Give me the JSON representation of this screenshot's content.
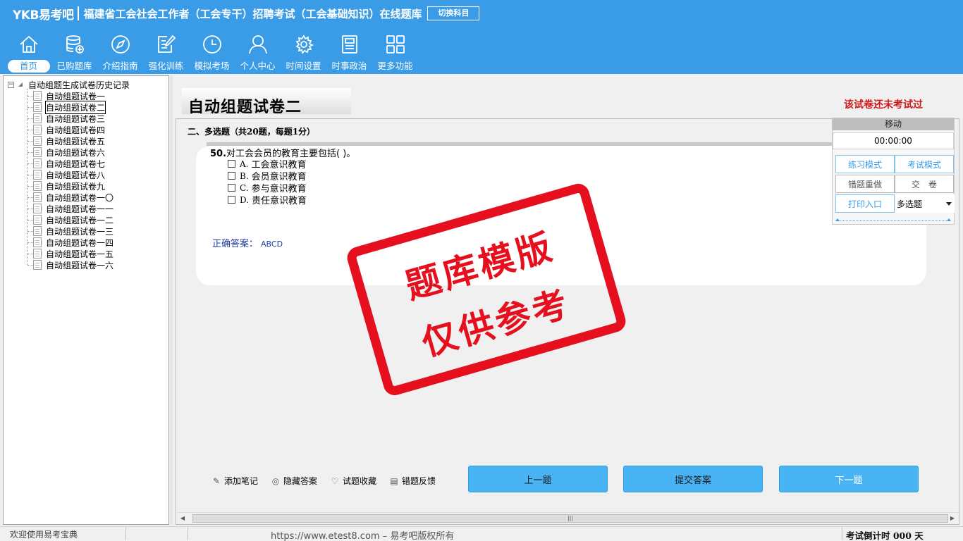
{
  "header": {
    "brand": "YKB易考吧",
    "title": "福建省工会社会工作者（工会专干）招聘考试（工会基础知识）在线题库",
    "switch_label": "切换科目"
  },
  "nav": [
    {
      "label": "首页",
      "icon": "home-icon",
      "active": true
    },
    {
      "label": "已购题库",
      "icon": "database-icon"
    },
    {
      "label": "介绍指南",
      "icon": "compass-icon"
    },
    {
      "label": "强化训练",
      "icon": "edit-icon"
    },
    {
      "label": "模拟考场",
      "icon": "clock-icon"
    },
    {
      "label": "个人中心",
      "icon": "user-icon"
    },
    {
      "label": "时间设置",
      "icon": "gear-icon"
    },
    {
      "label": "时事政治",
      "icon": "news-icon"
    },
    {
      "label": "更多功能",
      "icon": "grid-icon"
    }
  ],
  "tree": {
    "root": "自动组题生成试卷历史记录",
    "items": [
      "自动组题试卷一",
      "自动组题试卷二",
      "自动组题试卷三",
      "自动组题试卷四",
      "自动组题试卷五",
      "自动组题试卷六",
      "自动组题试卷七",
      "自动组题试卷八",
      "自动组题试卷九",
      "自动组题试卷一〇",
      "自动组题试卷一一",
      "自动组题试卷一二",
      "自动组题试卷一三",
      "自动组题试卷一四",
      "自动组题试卷一五",
      "自动组题试卷一六"
    ],
    "selected_index": 1
  },
  "exam": {
    "title": "自动组题试卷二",
    "status": "该试卷还未考试过",
    "section": "二、多选题（共20题，每题1分）"
  },
  "question": {
    "number": "50.",
    "text": "对工会会员的教育主要包括( )。",
    "options": [
      {
        "letter": "A.",
        "text": "工会意识教育"
      },
      {
        "letter": "B.",
        "text": "会员意识教育"
      },
      {
        "letter": "C.",
        "text": "参与意识教育"
      },
      {
        "letter": "D.",
        "text": "责任意识教育"
      }
    ],
    "answer_label": "正确答案：",
    "answer_value": "ABCD"
  },
  "stamp": {
    "line1": "题库模版",
    "line2": "仅供参考",
    "color": "#e60f1d"
  },
  "actions": {
    "add_note": "添加笔记",
    "hide_answer": "隐藏答案",
    "favorite": "试题收藏",
    "feedback": "错题反馈"
  },
  "buttons": {
    "prev": "上一题",
    "submit": "提交答案",
    "next": "下一题"
  },
  "float_panel": {
    "move": "移动",
    "timer": "00:00:00",
    "practice": "练习模式",
    "exam": "考试模式",
    "redo": "错题重做",
    "hand_in": "交　卷",
    "print": "打印入口",
    "type_select": "多选题"
  },
  "statusbar": {
    "welcome": "欢迎使用易考宝典",
    "copyright": "https://www.etest8.com – 易考吧版权所有",
    "countdown": "考试倒计时 000 天"
  },
  "colors": {
    "header": "#3a9be6",
    "button": "#48b4f4",
    "status_red": "#d01818"
  }
}
